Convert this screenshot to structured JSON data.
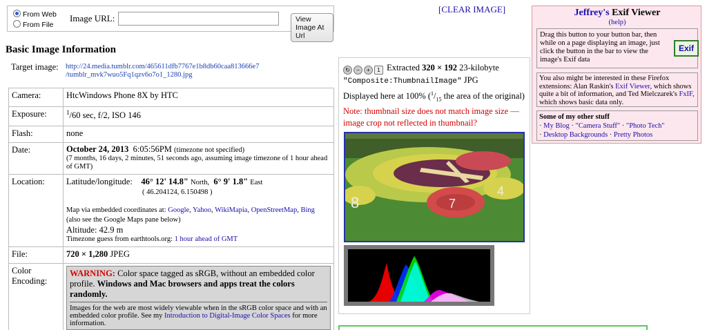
{
  "source": {
    "from_web": "From Web",
    "from_file": "From File",
    "url_label": "Image URL:",
    "url_value": "",
    "view_button": "View Image At Url"
  },
  "clear_image": "[CLEAR IMAGE]",
  "section_title": "Basic Image Information",
  "target": {
    "label": "Target image:",
    "url_line1": "http://24.media.tumblr.com/465611dfb7767e1b8db60caa813666e7",
    "url_line2": "/tumblr_mvk7wuo5Fq1qzv6o7o1_1280.jpg"
  },
  "rows": {
    "camera": {
      "label": "Camera:",
      "value": "HtcWindows Phone 8X by HTC"
    },
    "exposure": {
      "label": "Exposure:",
      "num": "1",
      "rest": "/60 sec, f/2, ISO 146"
    },
    "flash": {
      "label": "Flash:",
      "value": "none"
    },
    "date": {
      "label": "Date:",
      "date": "October 24, 2013",
      "time": "6:05:56PM",
      "tz": "(timezone not specified)",
      "note": "(7 months, 16 days, 2 minutes, 51 seconds ago, assuming image timezone of 1 hour ahead of GMT)"
    },
    "location": {
      "label": "Location:",
      "latlon_label": "Latitude/longitude:",
      "lat": "46° 12' 14.8\"",
      "lat_dir": "North,",
      "lon": "6° 9' 1.8\"",
      "lon_dir": "East",
      "decimal": "( 46.204124, 6.150498 )",
      "map_via": "Map via embedded coordinates at:",
      "maps": [
        "Google",
        "Yahoo",
        "WikiMapia",
        "OpenStreetMap",
        "Bing"
      ],
      "map_note": "(also see the Google Maps pane below)",
      "altitude": "Altitude: 42.9 m",
      "tz_guess": "Timezone guess from earthtools.org:",
      "tz_link": "1 hour ahead of GMT"
    },
    "file": {
      "label": "File:",
      "size": "720 × 1,280",
      "type": "JPEG"
    },
    "color": {
      "label1": "Color",
      "label2": "Encoding:",
      "warning_label": "WARNING:",
      "warning_text": "Color space tagged as sRGB, without an embedded color profile.",
      "warning_bold": "Windows and Mac browsers and apps treat the colors randomly.",
      "info_text": "Images for the web are most widely viewable when in the sRGB color space and with an embedded color profile. See my",
      "info_link": "Introduction to Digital-Image Color Spaces",
      "info_end": "for more information."
    }
  },
  "thumb": {
    "extracted": "Extracted",
    "dims": "320 × 192",
    "size": "23-kilobyte",
    "tag": "\"Composite:ThumbnailImage\"",
    "fmt": "JPG",
    "displayed": "Displayed here at 100% (",
    "frac_num": "1",
    "frac_den": "15",
    "displayed_end": "the area of the original)",
    "note": "Note: thumbnail size does not match image size — image crop not reflected in thumbnail?",
    "tool_icons": [
      "reset-icon",
      "zoom-out-icon",
      "zoom-in-icon",
      "actual-size-icon"
    ]
  },
  "sidebar": {
    "brand": "Jeffrey's",
    "title": "Exif Viewer",
    "help": "(help)",
    "drag_text": "Drag this button to your button bar, then while on a page displaying an image, just click the button in the bar to view the image's Exif data",
    "exif_button": "Exif",
    "ext_text1": "You also might be interested in these Firefox extensions: Alan Raskin's",
    "ext_link1": "Exif Viewer",
    "ext_text2": ", which shows quite a bit of information, and Ted Mielczarek's",
    "ext_link2": "FxIF",
    "ext_text3": ", which shows basic data only.",
    "other_title": "Some of my other stuff",
    "links": [
      "My Blog",
      "\"Camera Stuff\"",
      "\"Photo Tech\"",
      "Desktop Backgrounds",
      "Pretty Photos"
    ]
  },
  "colors": {
    "accent": "#1a0dab",
    "sidebar_bg": "#fde7ee",
    "thumb_border": "#2233aa",
    "warning": "#d00000"
  }
}
